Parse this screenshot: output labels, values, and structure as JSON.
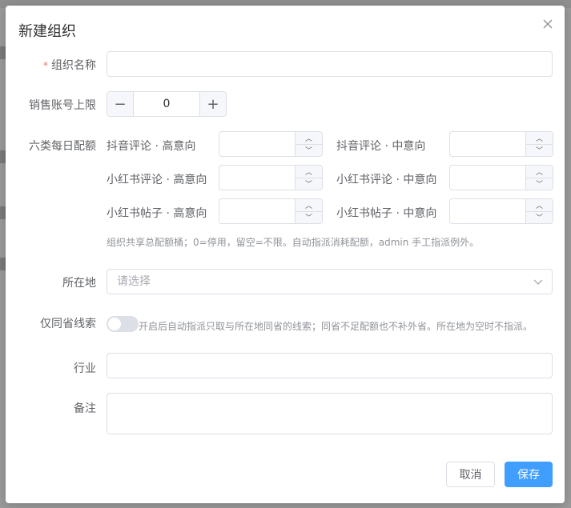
{
  "dialog": {
    "title": "新建组织",
    "fields": {
      "org_name": {
        "label": "组织名称",
        "required_mark": "*",
        "value": ""
      },
      "sales_limit": {
        "label": "销售账号上限",
        "value": "0",
        "minus": "−",
        "plus": "+"
      },
      "quota": {
        "label": "六类每日配额",
        "items": [
          {
            "label": "抖音评论 · 高意向",
            "value": ""
          },
          {
            "label": "抖音评论 · 中意向",
            "value": ""
          },
          {
            "label": "小红书评论 · 高意向",
            "value": ""
          },
          {
            "label": "小红书评论 · 中意向",
            "value": ""
          },
          {
            "label": "小红书帖子 · 高意向",
            "value": ""
          },
          {
            "label": "小红书帖子 · 中意向",
            "value": ""
          }
        ],
        "hint": "组织共享总配额桶；0=停用，留空=不限。自动指派消耗配额，admin 手工指派例外。"
      },
      "location": {
        "label": "所在地",
        "placeholder": "请选择"
      },
      "same_province": {
        "label": "仅同省线索",
        "enabled": false,
        "hint": "开启后自动指派只取与所在地同省的线索；同省不足配额也不补外省。所在地为空时不指派。"
      },
      "industry": {
        "label": "行业",
        "value": ""
      },
      "remark": {
        "label": "备注",
        "value": ""
      }
    },
    "buttons": {
      "cancel": "取消",
      "save": "保存"
    }
  },
  "colors": {
    "primary": "#409eff",
    "required": "#f56c6c",
    "border": "#dcdfe6"
  }
}
